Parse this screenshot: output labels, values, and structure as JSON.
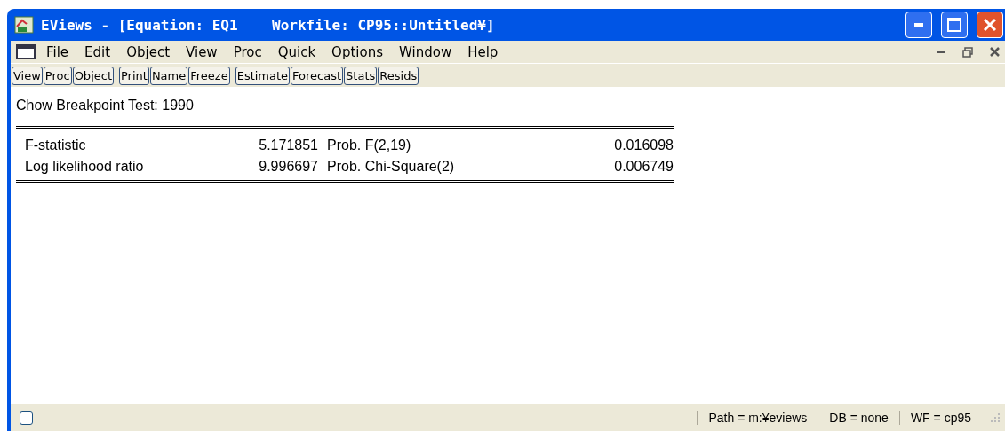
{
  "window": {
    "title": "EViews - [Equation: EQ1    Workfile: CP95::Untitled¥]"
  },
  "menu": [
    "File",
    "Edit",
    "Object",
    "View",
    "Proc",
    "Quick",
    "Options",
    "Window",
    "Help"
  ],
  "toolbar": [
    [
      "View",
      "Proc",
      "Object"
    ],
    [
      "Print",
      "Name",
      "Freeze"
    ],
    [
      "Estimate",
      "Forecast",
      "Stats",
      "Resids"
    ]
  ],
  "output": {
    "title": "Chow Breakpoint Test: 1990",
    "rows": [
      {
        "label": "F-statistic",
        "value": "5.171851",
        "prob_label": "Prob. F(2,19)",
        "prob": "0.016098"
      },
      {
        "label": "Log likelihood ratio",
        "value": "9.996697",
        "prob_label": "Prob. Chi-Square(2)",
        "prob": "0.006749"
      }
    ]
  },
  "status_bar": {
    "checked": false,
    "fields": [
      "Path = m:¥eviews",
      "DB = none",
      "WF = cp95"
    ]
  }
}
